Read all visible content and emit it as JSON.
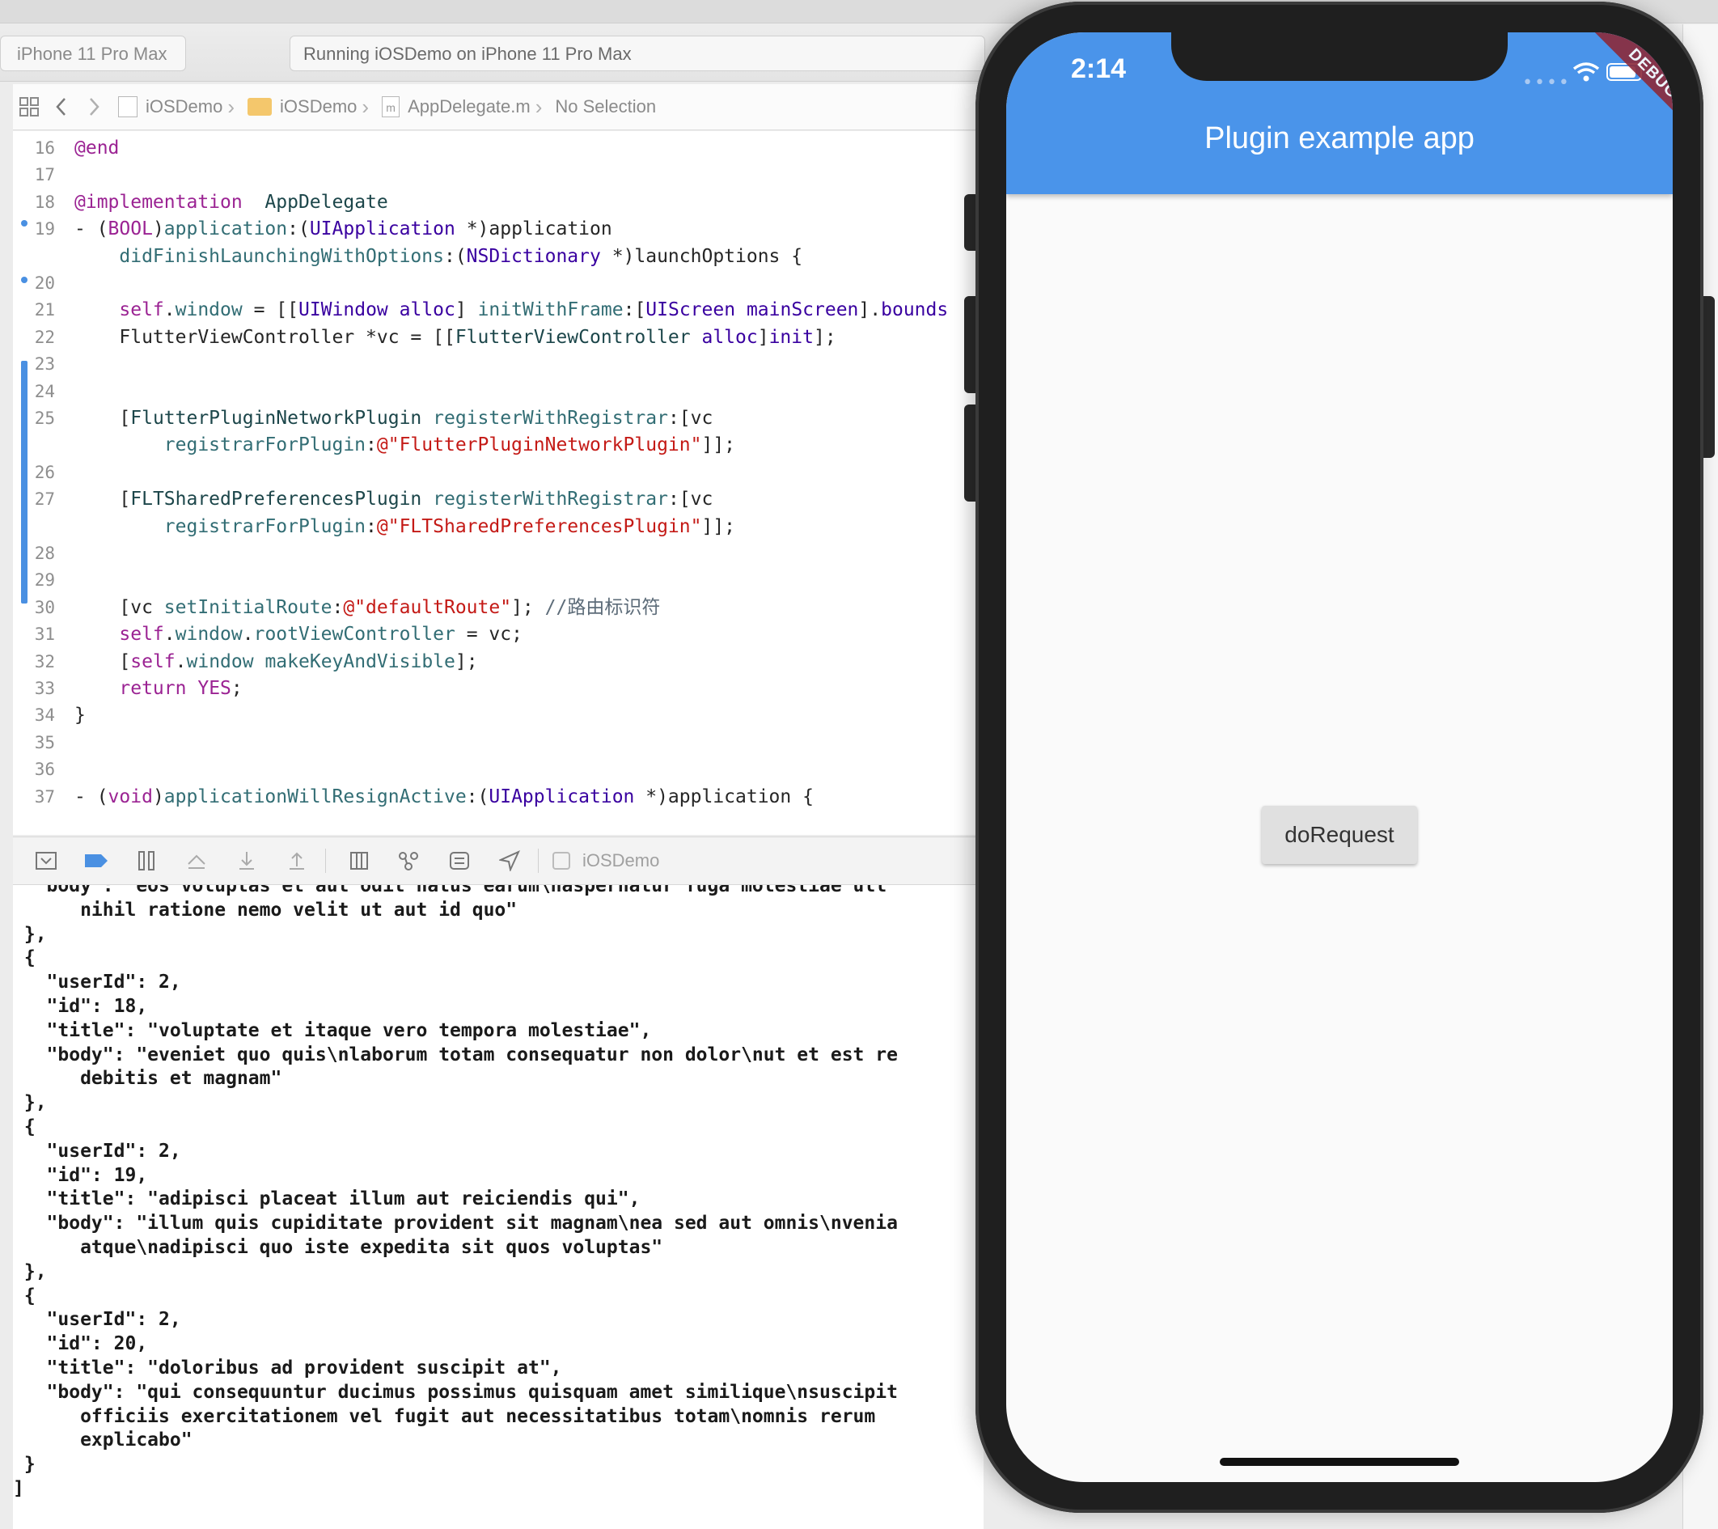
{
  "toolbar": {
    "scheme": "iPhone 11 Pro Max",
    "activity": "Running iOSDemo on iPhone 11 Pro Max"
  },
  "jumpbar": {
    "items": [
      "iOSDemo",
      "iOSDemo",
      "AppDelegate.m",
      "No Selection"
    ]
  },
  "editor": {
    "lines": [
      {
        "num": "16",
        "parts": [
          [
            "kw",
            "@end"
          ]
        ]
      },
      {
        "num": "17",
        "parts": []
      },
      {
        "num": "18",
        "parts": [
          [
            "kw",
            "@implementation"
          ],
          [
            "",
            "  "
          ],
          [
            "cls",
            "AppDelegate"
          ]
        ]
      },
      {
        "num": "19",
        "parts": [
          [
            "",
            "- ("
          ],
          [
            "kw",
            "BOOL"
          ],
          [
            "",
            ")"
          ],
          [
            "mt",
            "application"
          ],
          [
            "",
            ":("
          ],
          [
            "ty",
            "UIApplication"
          ],
          [
            "",
            " *)application"
          ]
        ]
      },
      {
        "num": "",
        "parts": [
          [
            "",
            "    "
          ],
          [
            "mt",
            "didFinishLaunchingWithOptions"
          ],
          [
            "",
            ":("
          ],
          [
            "ty",
            "NSDictionary"
          ],
          [
            "",
            " *)launchOptions {"
          ]
        ]
      },
      {
        "num": "20",
        "parts": []
      },
      {
        "num": "21",
        "parts": [
          [
            "",
            "    "
          ],
          [
            "kw",
            "self"
          ],
          [
            "",
            "."
          ],
          [
            "prop",
            "window"
          ],
          [
            "",
            " = [["
          ],
          [
            "ty",
            "UIWindow"
          ],
          [
            "",
            " "
          ],
          [
            "ty",
            "alloc"
          ],
          [
            "",
            "] "
          ],
          [
            "mt",
            "initWithFrame"
          ],
          [
            "",
            ":["
          ],
          [
            "ty",
            "UIScreen"
          ],
          [
            "",
            " "
          ],
          [
            "ty",
            "mainScreen"
          ],
          [
            "",
            "]."
          ],
          [
            "ty",
            "bounds"
          ]
        ]
      },
      {
        "num": "22",
        "parts": [
          [
            "",
            "    FlutterViewController *vc = [["
          ],
          [
            "cls",
            "FlutterViewController"
          ],
          [
            "",
            " "
          ],
          [
            "ty",
            "alloc"
          ],
          [
            "",
            "]"
          ],
          [
            "ty",
            "init"
          ],
          [
            "",
            "];"
          ]
        ]
      },
      {
        "num": "23",
        "parts": []
      },
      {
        "num": "24",
        "parts": []
      },
      {
        "num": "25",
        "parts": [
          [
            "",
            "    ["
          ],
          [
            "cls",
            "FlutterPluginNetworkPlugin"
          ],
          [
            "",
            " "
          ],
          [
            "mt",
            "registerWithRegistrar"
          ],
          [
            "",
            ":[vc"
          ]
        ]
      },
      {
        "num": "",
        "parts": [
          [
            "",
            "        "
          ],
          [
            "mt",
            "registrarForPlugin"
          ],
          [
            "",
            ":"
          ],
          [
            "str",
            "@\"FlutterPluginNetworkPlugin\""
          ],
          [
            "",
            "]];"
          ]
        ]
      },
      {
        "num": "26",
        "parts": []
      },
      {
        "num": "27",
        "parts": [
          [
            "",
            "    ["
          ],
          [
            "cls",
            "FLTSharedPreferencesPlugin"
          ],
          [
            "",
            " "
          ],
          [
            "mt",
            "registerWithRegistrar"
          ],
          [
            "",
            ":[vc"
          ]
        ]
      },
      {
        "num": "",
        "parts": [
          [
            "",
            "        "
          ],
          [
            "mt",
            "registrarForPlugin"
          ],
          [
            "",
            ":"
          ],
          [
            "str",
            "@\"FLTSharedPreferencesPlugin\""
          ],
          [
            "",
            "]];"
          ]
        ]
      },
      {
        "num": "28",
        "parts": []
      },
      {
        "num": "29",
        "parts": []
      },
      {
        "num": "30",
        "parts": [
          [
            "",
            "    [vc "
          ],
          [
            "mt",
            "setInitialRoute"
          ],
          [
            "",
            ":"
          ],
          [
            "str",
            "@\"defaultRoute\""
          ],
          [
            "",
            "]; "
          ],
          [
            "cm",
            "//路由标识符"
          ]
        ]
      },
      {
        "num": "31",
        "parts": [
          [
            "",
            "    "
          ],
          [
            "kw",
            "self"
          ],
          [
            "",
            "."
          ],
          [
            "prop",
            "window"
          ],
          [
            "",
            "."
          ],
          [
            "prop",
            "rootViewController"
          ],
          [
            "",
            " = vc;"
          ]
        ]
      },
      {
        "num": "32",
        "parts": [
          [
            "",
            "    ["
          ],
          [
            "kw",
            "self"
          ],
          [
            "",
            "."
          ],
          [
            "prop",
            "window"
          ],
          [
            "",
            " "
          ],
          [
            "mt",
            "makeKeyAndVisible"
          ],
          [
            "",
            "];"
          ]
        ]
      },
      {
        "num": "33",
        "parts": [
          [
            "",
            "    "
          ],
          [
            "kw",
            "return"
          ],
          [
            "",
            " "
          ],
          [
            "kw",
            "YES"
          ],
          [
            "",
            ";"
          ]
        ]
      },
      {
        "num": "34",
        "parts": [
          [
            "",
            "}"
          ]
        ]
      },
      {
        "num": "35",
        "parts": []
      },
      {
        "num": "36",
        "parts": []
      },
      {
        "num": "37",
        "parts": [
          [
            "",
            "- ("
          ],
          [
            "kw",
            "void"
          ],
          [
            "",
            ")"
          ],
          [
            "mt",
            "applicationWillResignActive"
          ],
          [
            "",
            ":("
          ],
          [
            "ty",
            "UIApplication"
          ],
          [
            "",
            " *)application {"
          ]
        ]
      }
    ]
  },
  "debugbar": {
    "target": "iOSDemo"
  },
  "console": {
    "lines": [
      "  \"body\": \"eos voluptas et aut odit natus earum\\naspernatur fuga molestiae ull",
      "      nihil ratione nemo velit ut aut id quo\"",
      " },",
      " {",
      "   \"userId\": 2,",
      "   \"id\": 18,",
      "   \"title\": \"voluptate et itaque vero tempora molestiae\",",
      "   \"body\": \"eveniet quo quis\\nlaborum totam consequatur non dolor\\nut et est re",
      "      debitis et magnam\"",
      " },",
      " {",
      "   \"userId\": 2,",
      "   \"id\": 19,",
      "   \"title\": \"adipisci placeat illum aut reiciendis qui\",",
      "   \"body\": \"illum quis cupiditate provident sit magnam\\nea sed aut omnis\\nvenia",
      "      atque\\nadipisci quo iste expedita sit quos voluptas\"",
      " },",
      " {",
      "   \"userId\": 2,",
      "   \"id\": 20,",
      "   \"title\": \"doloribus ad provident suscipit at\",",
      "   \"body\": \"qui consequuntur ducimus possimus quisquam amet similique\\nsuscipit",
      "      officiis exercitationem vel fugit aut necessitatibus totam\\nomnis rerum",
      "      explicabo\"",
      " }",
      "]"
    ]
  },
  "simulator": {
    "time": "2:14",
    "app_title": "Plugin example app",
    "debug_banner": "DEBUG",
    "button_label": "doRequest",
    "appbar_color": "#4a94ea"
  },
  "colors": {
    "keyword": "#9b2393",
    "type": "#3900a0",
    "method": "#326d74",
    "string": "#c41a16",
    "comment": "#5d6c79",
    "change_bar": "#4a90e2"
  }
}
